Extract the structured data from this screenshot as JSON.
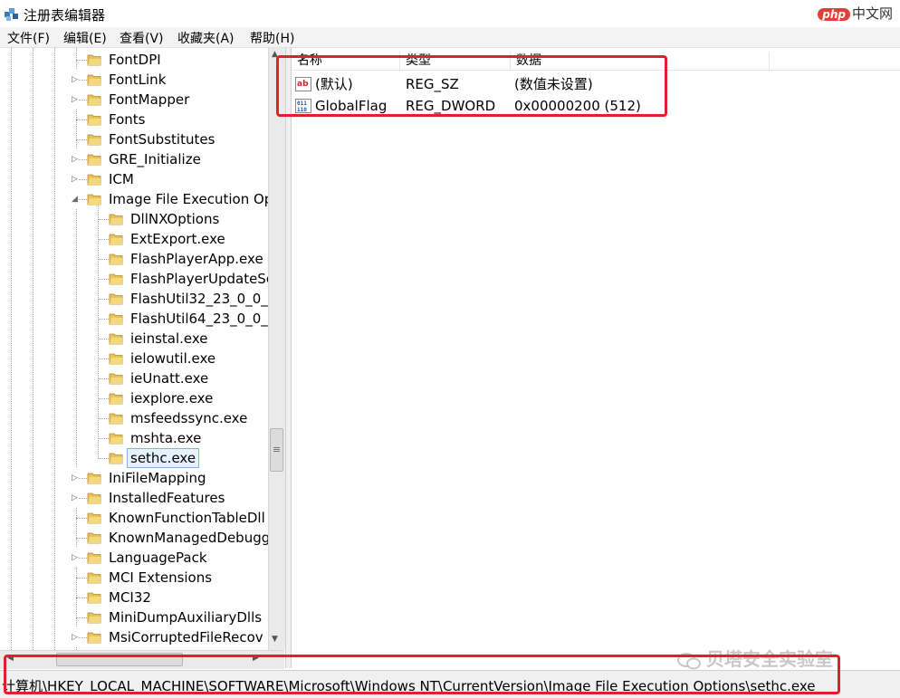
{
  "window": {
    "title": "注册表编辑器",
    "watermark_php": "php",
    "watermark_site": "中文网"
  },
  "menu": [
    "文件(F)",
    "编辑(E)",
    "查看(V)",
    "收藏夹(A)",
    "帮助(H)"
  ],
  "tree": {
    "items": [
      {
        "label": "FontDPI",
        "expandable": false
      },
      {
        "label": "FontLink",
        "expandable": true
      },
      {
        "label": "FontMapper",
        "expandable": true
      },
      {
        "label": "Fonts",
        "expandable": false
      },
      {
        "label": "FontSubstitutes",
        "expandable": false
      },
      {
        "label": "GRE_Initialize",
        "expandable": true
      },
      {
        "label": "ICM",
        "expandable": true
      },
      {
        "label": "Image File Execution Op",
        "expandable": true,
        "expanded": true
      },
      {
        "label": "DllNXOptions",
        "expandable": false
      },
      {
        "label": "ExtExport.exe",
        "expandable": false
      },
      {
        "label": "FlashPlayerApp.exe",
        "expandable": false
      },
      {
        "label": "FlashPlayerUpdateSe",
        "expandable": false
      },
      {
        "label": "FlashUtil32_23_0_0_2",
        "expandable": false
      },
      {
        "label": "FlashUtil64_23_0_0_2",
        "expandable": false
      },
      {
        "label": "ieinstal.exe",
        "expandable": false
      },
      {
        "label": "ielowutil.exe",
        "expandable": false
      },
      {
        "label": "ieUnatt.exe",
        "expandable": false
      },
      {
        "label": "iexplore.exe",
        "expandable": false
      },
      {
        "label": "msfeedssync.exe",
        "expandable": false
      },
      {
        "label": "mshta.exe",
        "expandable": false
      },
      {
        "label": "sethc.exe",
        "expandable": false,
        "selected": true
      },
      {
        "label": "IniFileMapping",
        "expandable": true
      },
      {
        "label": "InstalledFeatures",
        "expandable": true
      },
      {
        "label": "KnownFunctionTableDll",
        "expandable": false
      },
      {
        "label": "KnownManagedDebugg",
        "expandable": false
      },
      {
        "label": "LanguagePack",
        "expandable": true
      },
      {
        "label": "MCI Extensions",
        "expandable": false
      },
      {
        "label": "MCI32",
        "expandable": false
      },
      {
        "label": "MiniDumpAuxiliaryDlls",
        "expandable": false
      },
      {
        "label": "MsiCorruptedFileRecov",
        "expandable": true
      }
    ]
  },
  "list": {
    "headers": [
      "名称",
      "类型",
      "数据"
    ],
    "rows": [
      {
        "name": "(默认)",
        "type": "REG_SZ",
        "data": "(数值未设置)",
        "icon": "string-value-icon"
      },
      {
        "name": "GlobalFlag",
        "type": "REG_DWORD",
        "data": "0x00000200 (512)",
        "icon": "binary-value-icon"
      }
    ]
  },
  "status": {
    "path": "计算机\\HKEY_LOCAL_MACHINE\\SOFTWARE\\Microsoft\\Windows NT\\CurrentVersion\\Image File Execution Options\\sethc.exe"
  },
  "watermark_bottom": "贝塔安全实验室",
  "colors": {
    "highlight_box": "#e0202a",
    "selection_bg": "#e5f1fb",
    "folder": "#e8c25a"
  }
}
